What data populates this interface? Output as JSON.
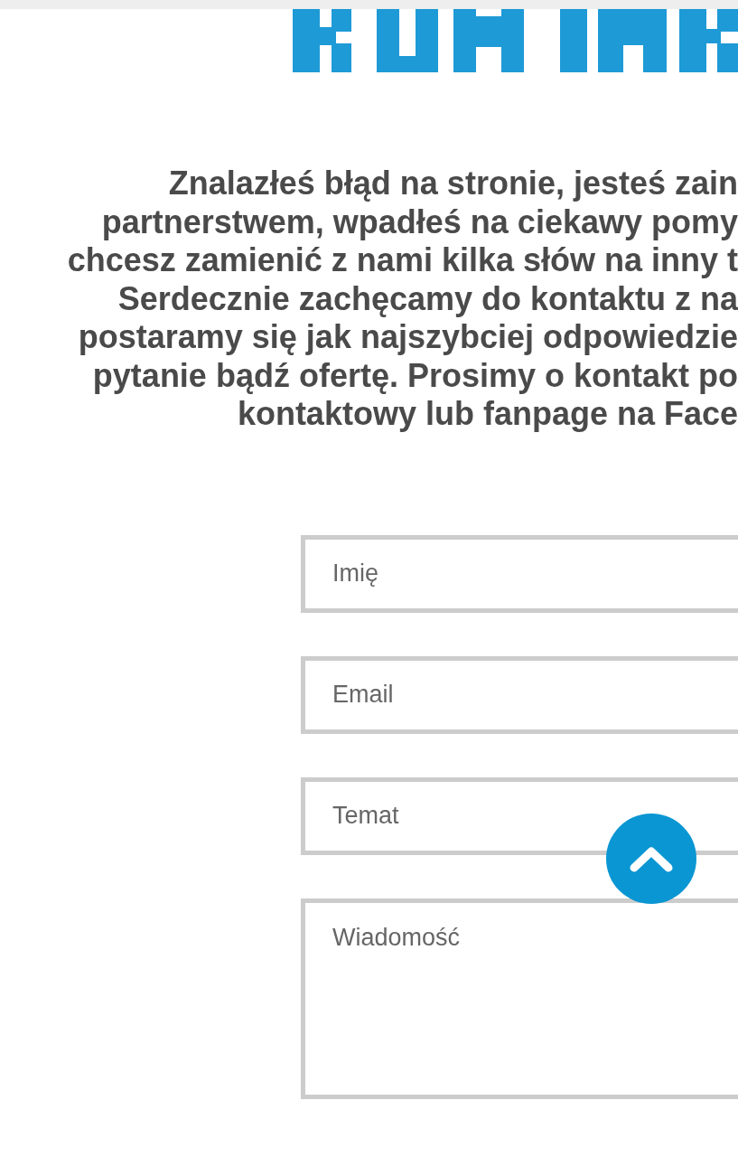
{
  "intro_lines": [
    "Znalazłeś błąd na stronie, jesteś zain",
    "partnerstwem, wpadłeś na ciekawy pomy",
    "chcesz zamienić z nami kilka słów na inny t",
    "Serdecznie zachęcamy do kontaktu z na",
    "postaramy się jak najszybciej odpowiedzie",
    "pytanie bądź ofertę. Prosimy o kontakt po",
    "kontaktowy lub fanpage na Face"
  ],
  "form": {
    "fields": [
      {
        "kind": "input",
        "placeholder": "Imię"
      },
      {
        "kind": "input",
        "placeholder": "Email"
      },
      {
        "kind": "input",
        "placeholder": "Temat"
      },
      {
        "kind": "textarea",
        "placeholder": "Wiadomość"
      }
    ]
  }
}
